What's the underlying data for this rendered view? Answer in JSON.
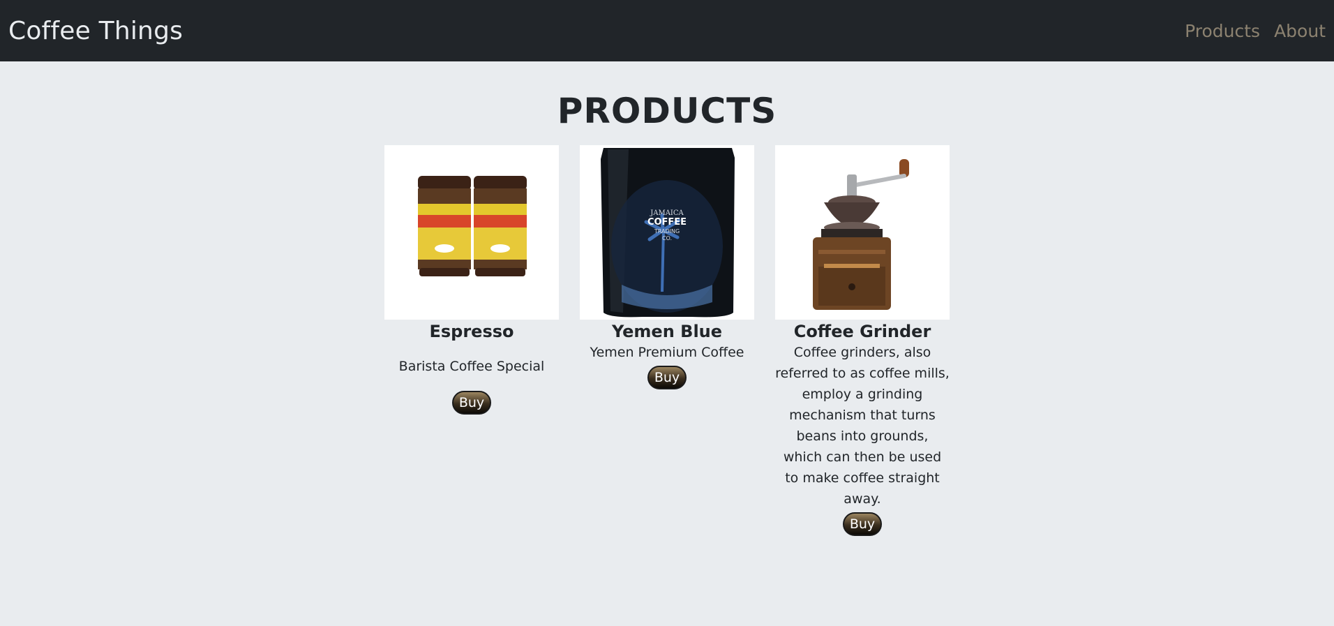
{
  "navbar": {
    "brand": "Coffee Things",
    "links": [
      "Products",
      "About"
    ]
  },
  "main": {
    "title": "PRODUCTS",
    "products": [
      {
        "name": "Espresso",
        "description": "Barista Coffee Special",
        "buy_label": "Buy",
        "image": "instant-coffee-jars-image"
      },
      {
        "name": "Yemen Blue",
        "description": "Yemen Premium Coffee",
        "buy_label": "Buy",
        "image": "coffee-bag-image",
        "image_text": [
          "JAMAICA",
          "COFFEE",
          "TRADING",
          "CO."
        ]
      },
      {
        "name": "Coffee Grinder",
        "description": "Coffee grinders, also referred to as coffee mills, employ a grinding mechanism that turns beans into grounds, which can then be used to make coffee straight away.",
        "buy_label": "Buy",
        "image": "coffee-grinder-image"
      }
    ]
  },
  "colors": {
    "navbar_bg": "#212529",
    "page_bg": "#e9ecef",
    "nav_link": "#8c8270"
  }
}
